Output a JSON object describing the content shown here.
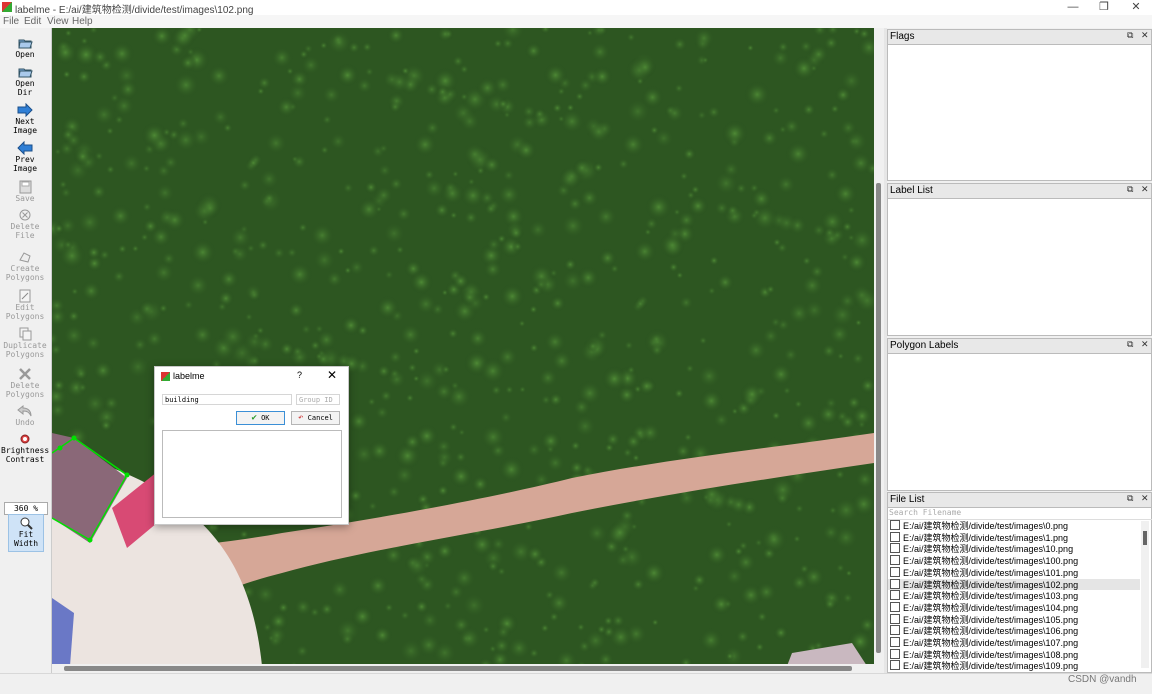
{
  "window": {
    "title": "labelme - E:/ai/建筑物检测/divide/test/images\\102.png",
    "minimize": "—",
    "maximize": "❐",
    "close": "✕"
  },
  "menu": [
    "File",
    "Edit",
    "View",
    "Help"
  ],
  "toolbar": {
    "open": [
      "Open"
    ],
    "open_dir": [
      "Open",
      "Dir"
    ],
    "next_image": [
      "Next",
      "Image"
    ],
    "prev_image": [
      "Prev",
      "Image"
    ],
    "save": [
      "Save"
    ],
    "delete_file": [
      "Delete",
      "File"
    ],
    "create_polygons": [
      "Create",
      "Polygons"
    ],
    "edit_polygons": [
      "Edit",
      "Polygons"
    ],
    "duplicate_polygons": [
      "Duplicate",
      "Polygons"
    ],
    "delete_polygons": [
      "Delete",
      "Polygons"
    ],
    "undo": [
      "Undo"
    ],
    "brightness": [
      "Brightness",
      "Contrast"
    ],
    "zoom": "360 %",
    "fit_width": [
      "Fit",
      "Width"
    ]
  },
  "docks": {
    "flags": "Flags",
    "label_list": "Label List",
    "polygon_labels": "Polygon Labels",
    "file_list": "File List",
    "float_icon": "⧉",
    "close_icon": "✕"
  },
  "file_list": {
    "search_placeholder": "Search Filename",
    "files": [
      "E:/ai/建筑物检测/divide/test/images\\0.png",
      "E:/ai/建筑物检测/divide/test/images\\1.png",
      "E:/ai/建筑物检测/divide/test/images\\10.png",
      "E:/ai/建筑物检测/divide/test/images\\100.png",
      "E:/ai/建筑物检测/divide/test/images\\101.png",
      "E:/ai/建筑物检测/divide/test/images\\102.png",
      "E:/ai/建筑物检测/divide/test/images\\103.png",
      "E:/ai/建筑物检测/divide/test/images\\104.png",
      "E:/ai/建筑物检测/divide/test/images\\105.png",
      "E:/ai/建筑物检测/divide/test/images\\106.png",
      "E:/ai/建筑物检测/divide/test/images\\107.png",
      "E:/ai/建筑物检测/divide/test/images\\108.png",
      "E:/ai/建筑物检测/divide/test/images\\109.png"
    ],
    "selected_index": 5
  },
  "dialog": {
    "title": "labelme",
    "help": "?",
    "close": "✕",
    "label_value": "building",
    "group_id_placeholder": "Group ID",
    "ok": "OK",
    "cancel": "Cancel"
  },
  "watermark": "CSDN @vandh",
  "colors": {
    "polygon": "#00e000",
    "selection": "#cfe3f7",
    "road": "#d9a898"
  }
}
